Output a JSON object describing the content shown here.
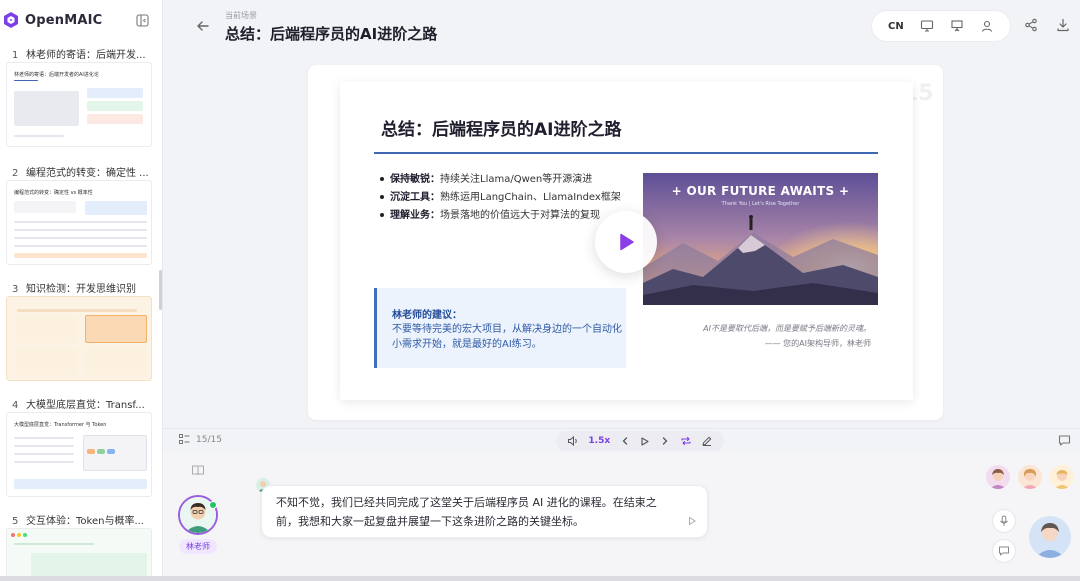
{
  "app": {
    "brand": "OpenMAIC"
  },
  "sidebar": {
    "scenes": [
      {
        "num": "1",
        "title": "林老师的寄语：后端开发...",
        "thumb_title": "林老师的寄语：后端开发者的AI进化论"
      },
      {
        "num": "2",
        "title": "编程范式的转变：确定性 ...",
        "thumb_title": "编程范式的转变：确定性 vs 概率性"
      },
      {
        "num": "3",
        "title": "知识检测：开发思维识别",
        "thumb_title": ""
      },
      {
        "num": "4",
        "title": "大模型底层直觉：Transf...",
        "thumb_title": "大模型底层直觉：Transformer 与 Token"
      },
      {
        "num": "5",
        "title": "交互体验：Token与概率...",
        "thumb_title": ""
      }
    ]
  },
  "header": {
    "breadcrumb": "当前场景",
    "title": "总结：后端程序员的AI进阶之路",
    "lang": "CN"
  },
  "slide": {
    "page_watermark": "15",
    "title": "总结：后端程序员的AI进阶之路",
    "bullets": [
      {
        "key": "保持敏锐：",
        "text": "持续关注Llama/Qwen等开源演进"
      },
      {
        "key": "沉淀工具：",
        "text": "熟练运用LangChain、LlamaIndex框架"
      },
      {
        "key": "理解业务：",
        "text": "场景落地的价值远大于对算法的复现"
      }
    ],
    "advice_heading": "林老师的建议：",
    "advice_body": "不要等待完美的宏大项目，从解决身边的一个自动化小需求开始，就是最好的AI练习。",
    "hero_title": "+ OUR FUTURE AWAITS +",
    "hero_subtitle": "Thank You | Let's Rise Together",
    "quote": "AI不是要取代后端，而是要赋予后端新的灵魂。",
    "signature": "—— 您的AI架构导师，林老师"
  },
  "controls": {
    "page_indicator": "15/15",
    "speed": "1.5x"
  },
  "discussion": {
    "teacher_name": "林老师",
    "message": "不知不觉，我们已经共同完成了这堂关于后端程序员 AI 进化的课程。在结束之前，我想和大家一起复盘并展望一下这条进阶之路的关键坐标。"
  },
  "colors": {
    "accent": "#7b3fe4",
    "slide_blue": "#3f67b2",
    "online": "#22c55e"
  }
}
